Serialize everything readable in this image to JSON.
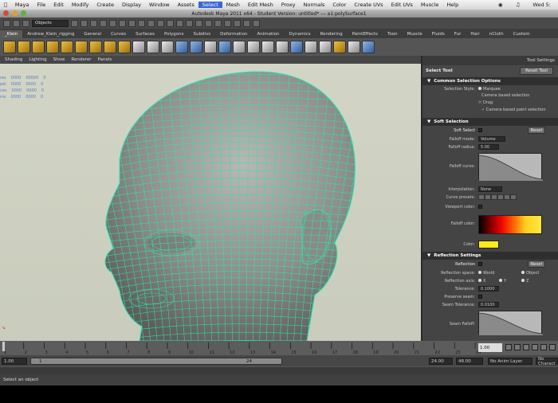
{
  "macmenu": {
    "items": [
      "Maya",
      "File",
      "Edit",
      "Modify",
      "Create",
      "Display",
      "Window",
      "Assets",
      "Select",
      "Mesh",
      "Edit Mesh",
      "Proxy",
      "Normals",
      "Color",
      "Create UVs",
      "Edit UVs",
      "Muscle",
      "Help"
    ],
    "selected": "Select",
    "user": "Wed 5:"
  },
  "title": "Autodesk Maya 2011 x64 - Student Version: untitled*   ---   a1:polySurface1",
  "statusline": {
    "mode": "Objects"
  },
  "shelf_tabs": [
    "_Klein",
    "Andrew_Klein_rigging",
    "General",
    "Curves",
    "Surfaces",
    "Polygons",
    "Subdivs",
    "Deformation",
    "Animation",
    "Dynamics",
    "Rendering",
    "PaintEffects",
    "Toon",
    "Muscle",
    "Fluids",
    "Fur",
    "Hair",
    "nCloth",
    "Custom"
  ],
  "panel_menu": [
    "Shading",
    "Lighting",
    "Show",
    "Renderer",
    "Panels"
  ],
  "hud_rows": [
    [
      "res",
      "0000",
      "00000",
      "0"
    ],
    [
      "pel",
      "0000",
      "0000",
      "0"
    ],
    [
      "ces",
      "0000",
      "0000",
      "0"
    ],
    [
      "ms",
      "0000",
      "0000",
      "0"
    ]
  ],
  "tool_settings": {
    "header": "Tool Settings",
    "tool_name": "Select Tool",
    "reset_label": "Reset Tool",
    "common_section": "Common Selection Options",
    "selection_style_label": "Selection Style:",
    "marquee": "Marquee",
    "camera_based": "Camera based selection",
    "drag": "Drag",
    "camera_paint": "Camera based paint selection",
    "soft_section": "Soft Selection",
    "soft_select_label": "Soft Select",
    "soft_reset": "Reset",
    "falloff_mode_label": "Falloff mode:",
    "falloff_mode_value": "Volume",
    "falloff_radius_label": "Falloff radius:",
    "falloff_radius_value": "5.00",
    "falloff_curve_label": "Falloff curve:",
    "interpolation_label": "Interpolation:",
    "interpolation_value": "None",
    "curve_presets_label": "Curve presets:",
    "viewport_color_label": "Viewport color:",
    "falloff_color_label": "Falloff color:",
    "color_label": "Color:",
    "reflection_section": "Reflection Settings",
    "reflection_label": "Reflection",
    "reflection_reset": "Reset",
    "reflection_space_label": "Reflection space:",
    "world": "World",
    "object": "Object",
    "reflection_axis_label": "Reflection axis:",
    "axes": [
      "X",
      "Y",
      "Z"
    ],
    "tolerance_label": "Tolerance:",
    "tolerance_value": "0.1000",
    "preserve_seam_label": "Preserve seam:",
    "seam_tolerance_label": "Seam Tolerance:",
    "seam_tolerance_value": "0.0100",
    "seam_falloff_label": "Seam Falloff:"
  },
  "timeline": {
    "ticks": [
      "1",
      "2",
      "3",
      "4",
      "5",
      "6",
      "7",
      "8",
      "9",
      "10",
      "11",
      "12",
      "13",
      "14",
      "15",
      "16",
      "17",
      "18",
      "19",
      "20",
      "21",
      "22",
      "23",
      "24"
    ],
    "current": "1.00"
  },
  "range": {
    "start": "1.00",
    "inner_start": "1",
    "inner_end": "24",
    "end": "24.00",
    "max": "48.00",
    "anim_layer": "No Anim Layer",
    "character": "No Charact"
  },
  "helpline": "Select an object",
  "colors": {
    "wire": "#29e6b0",
    "viewport_bg": "#d2d5c5",
    "panel_bg": "#444444"
  }
}
